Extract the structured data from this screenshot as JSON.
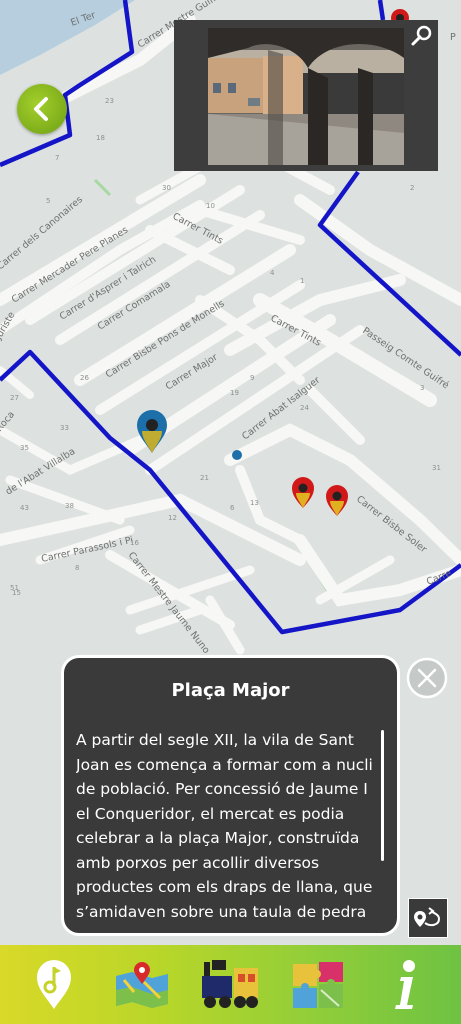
{
  "map": {
    "street_labels": {
      "ter": "El Ter",
      "mestre_guifre": "Carrer Mestre Guifré",
      "canonaires": "Carrer dels Canonaires",
      "mercader": "Carrer Mercader Pere Planes",
      "tints1": "Carrer Tints",
      "tints2": "Carrer Tints",
      "asprer": "Carrer d'Asprer i Talrich",
      "comamala": "Carrer Comamala",
      "bisbe_pons": "Carrer Bisbe Pons de Monells",
      "major": "Carrer Major",
      "abat_isalguer": "Carrer Abat Isalguer",
      "passeig": "Passeig Comte Guifré",
      "abat_villalba": "de l'Abat Villalba",
      "parassols": "Carrer Parassols i Pi",
      "mestre_jaume": "Carrer Mestre Jaume Nuno",
      "bisbe_soler": "Carrer Bisbe Soler",
      "juristes": "Juriste",
      "roca": "Roca",
      "right_edge": "Carre",
      "edge_p": "P"
    },
    "building_numbers": [
      "23",
      "7",
      "18",
      "11",
      "30",
      "10",
      "5",
      "4",
      "1",
      "27",
      "26",
      "9",
      "19",
      "33",
      "35",
      "24",
      "43",
      "21",
      "38",
      "51",
      "3",
      "31",
      "16",
      "2",
      "12",
      "13",
      "8",
      "6",
      "15"
    ]
  },
  "photo_panel": {
    "zoom_icon": "magnifier-icon",
    "caption": ""
  },
  "info_card": {
    "title": "Plaça Major",
    "body": "A partir del segle XII, la vila de Sant Joan es comença a formar com a nucli de població. Per concessió de Jaume I el Conqueridor, el mercat es podia celebrar a la plaça Major, construïda amb porxos per acollir diversos productes com els draps de llana, que s’amidaven sobre una taula de pedra ubicada permanentment a la plaça."
  },
  "icons": {
    "back": "chevron-left-icon",
    "close": "close-icon",
    "route": "route-icon"
  },
  "nav": [
    {
      "name": "audio-guide-icon"
    },
    {
      "name": "map-icon"
    },
    {
      "name": "train-icon"
    },
    {
      "name": "puzzle-icon"
    },
    {
      "name": "info-icon"
    }
  ],
  "colors": {
    "route": "#1515c8",
    "card": "#3a3a3a",
    "bar_start": "#d9d928",
    "bar_end": "#6ec242",
    "pin_red": "#d01a1a",
    "pin_blue": "#1c6fa8",
    "back_green": "#8ac020"
  }
}
